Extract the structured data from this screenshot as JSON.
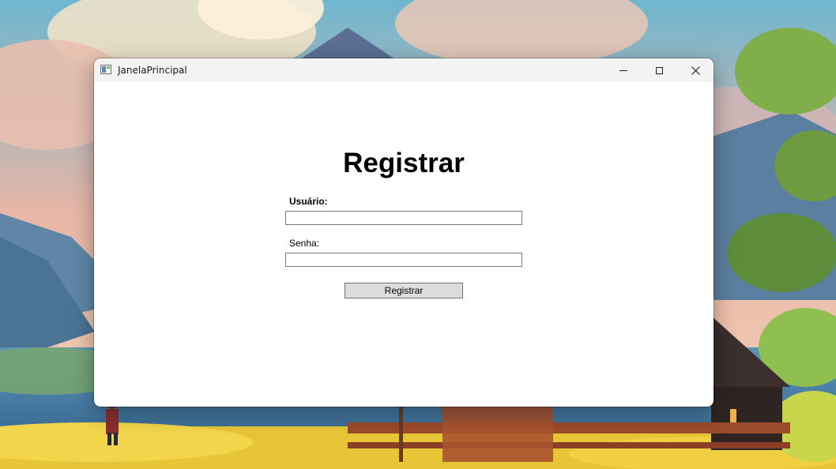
{
  "window": {
    "title": "JanelaPrincipal",
    "icons": {
      "app": "app-window-icon",
      "minimize": "minimize-icon",
      "maximize": "maximize-icon",
      "close": "close-icon"
    }
  },
  "form": {
    "heading": "Registrar",
    "username_label": "Usuário:",
    "username_value": "",
    "password_label": "Senha:",
    "password_value": "",
    "submit_label": "Registrar"
  },
  "colors": {
    "titlebar": "#f3f3f3",
    "button_bg": "#dddddd",
    "button_border": "#707070"
  }
}
